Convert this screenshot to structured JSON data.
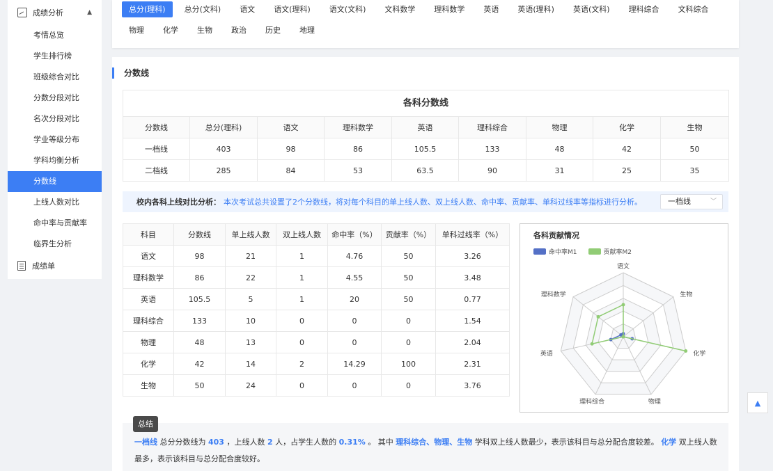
{
  "sidebar": {
    "group_label": "成绩分析",
    "group_icon": "chart-icon",
    "items": [
      {
        "label": "考情总览"
      },
      {
        "label": "学生排行榜"
      },
      {
        "label": "班级综合对比"
      },
      {
        "label": "分数分段对比"
      },
      {
        "label": "名次分段对比"
      },
      {
        "label": "学业等级分布"
      },
      {
        "label": "学科均衡分析"
      },
      {
        "label": "分数线",
        "active": true
      },
      {
        "label": "上线人数对比"
      },
      {
        "label": "命中率与贡献率"
      },
      {
        "label": "临界生分析"
      }
    ],
    "footer_label": "成绩单",
    "footer_icon": "document-icon"
  },
  "tabs": [
    "总分(理科)",
    "总分(文科)",
    "语文",
    "语文(理科)",
    "语文(文科)",
    "文科数学",
    "理科数学",
    "英语",
    "英语(理科)",
    "英语(文科)",
    "理科综合",
    "文科综合",
    "物理",
    "化学",
    "生物",
    "政治",
    "历史",
    "地理"
  ],
  "active_tab": "总分(理科)",
  "section_title": "分数线",
  "score_table": {
    "caption": "各科分数线",
    "headers": [
      "分数线",
      "总分(理科)",
      "语文",
      "理科数学",
      "英语",
      "理科综合",
      "物理",
      "化学",
      "生物"
    ],
    "rows": [
      [
        "一档线",
        "403",
        "98",
        "86",
        "105.5",
        "133",
        "48",
        "42",
        "50"
      ],
      [
        "二档线",
        "285",
        "84",
        "53",
        "63.5",
        "90",
        "31",
        "25",
        "35"
      ]
    ]
  },
  "notice": {
    "label": "校内各科上线对比分析：",
    "description": "本次考试总共设置了2个分数线，将对每个科目的单上线人数、双上线人数、命中率、贡献率、单科过线率等指标进行分析。",
    "select_value": "一档线"
  },
  "compare_table": {
    "headers": [
      "科目",
      "分数线",
      "单上线人数",
      "双上线人数",
      "命中率（%）",
      "贡献率（%）",
      "单科过线率（%）"
    ],
    "rows": [
      [
        "语文",
        "98",
        "21",
        "1",
        "4.76",
        "50",
        "3.26"
      ],
      [
        "理科数学",
        "86",
        "22",
        "1",
        "4.55",
        "50",
        "3.48"
      ],
      [
        "英语",
        "105.5",
        "5",
        "1",
        "20",
        "50",
        "0.77"
      ],
      [
        "理科综合",
        "133",
        "10",
        "0",
        "0",
        "0",
        "1.54"
      ],
      [
        "物理",
        "48",
        "13",
        "0",
        "0",
        "0",
        "2.04"
      ],
      [
        "化学",
        "42",
        "14",
        "2",
        "14.29",
        "100",
        "2.31"
      ],
      [
        "生物",
        "50",
        "24",
        "0",
        "0",
        "0",
        "3.76"
      ]
    ]
  },
  "chart_data": {
    "type": "radar",
    "title": "各科贡献情况",
    "indicators": [
      "语文",
      "生物",
      "化学",
      "物理",
      "理科综合",
      "英语",
      "理科数学"
    ],
    "max": 100,
    "series": [
      {
        "name": "命中率M1",
        "color": "#5470c6",
        "values": [
          4.76,
          0,
          14.29,
          0,
          0,
          20,
          4.55
        ]
      },
      {
        "name": "贡献率M2",
        "color": "#91cc75",
        "values": [
          50,
          0,
          100,
          0,
          0,
          50,
          50
        ]
      }
    ]
  },
  "summary": {
    "badge": "总结",
    "parts": [
      {
        "text": "一档线",
        "hl": true
      },
      {
        "text": " 总分分数线为 ",
        "hl": false
      },
      {
        "text": "403",
        "hl": true
      },
      {
        "text": " ，上线人数 ",
        "hl": false
      },
      {
        "text": "2",
        "hl": true
      },
      {
        "text": " 人，占学生人数的 ",
        "hl": false
      },
      {
        "text": "0.31%",
        "hl": true
      },
      {
        "text": " 。 其中 ",
        "hl": false
      },
      {
        "text": "理科综合、物理、生物",
        "hl": true
      },
      {
        "text": " 学科双上线人数最少，表示该科目与总分配合度较差。 ",
        "hl": false
      },
      {
        "text": "化学",
        "hl": true
      },
      {
        "text": " 双上线人数最多，表示该科目与总分配合度较好。",
        "hl": false
      }
    ]
  },
  "back_to_top_icon": "arrow-up-icon"
}
